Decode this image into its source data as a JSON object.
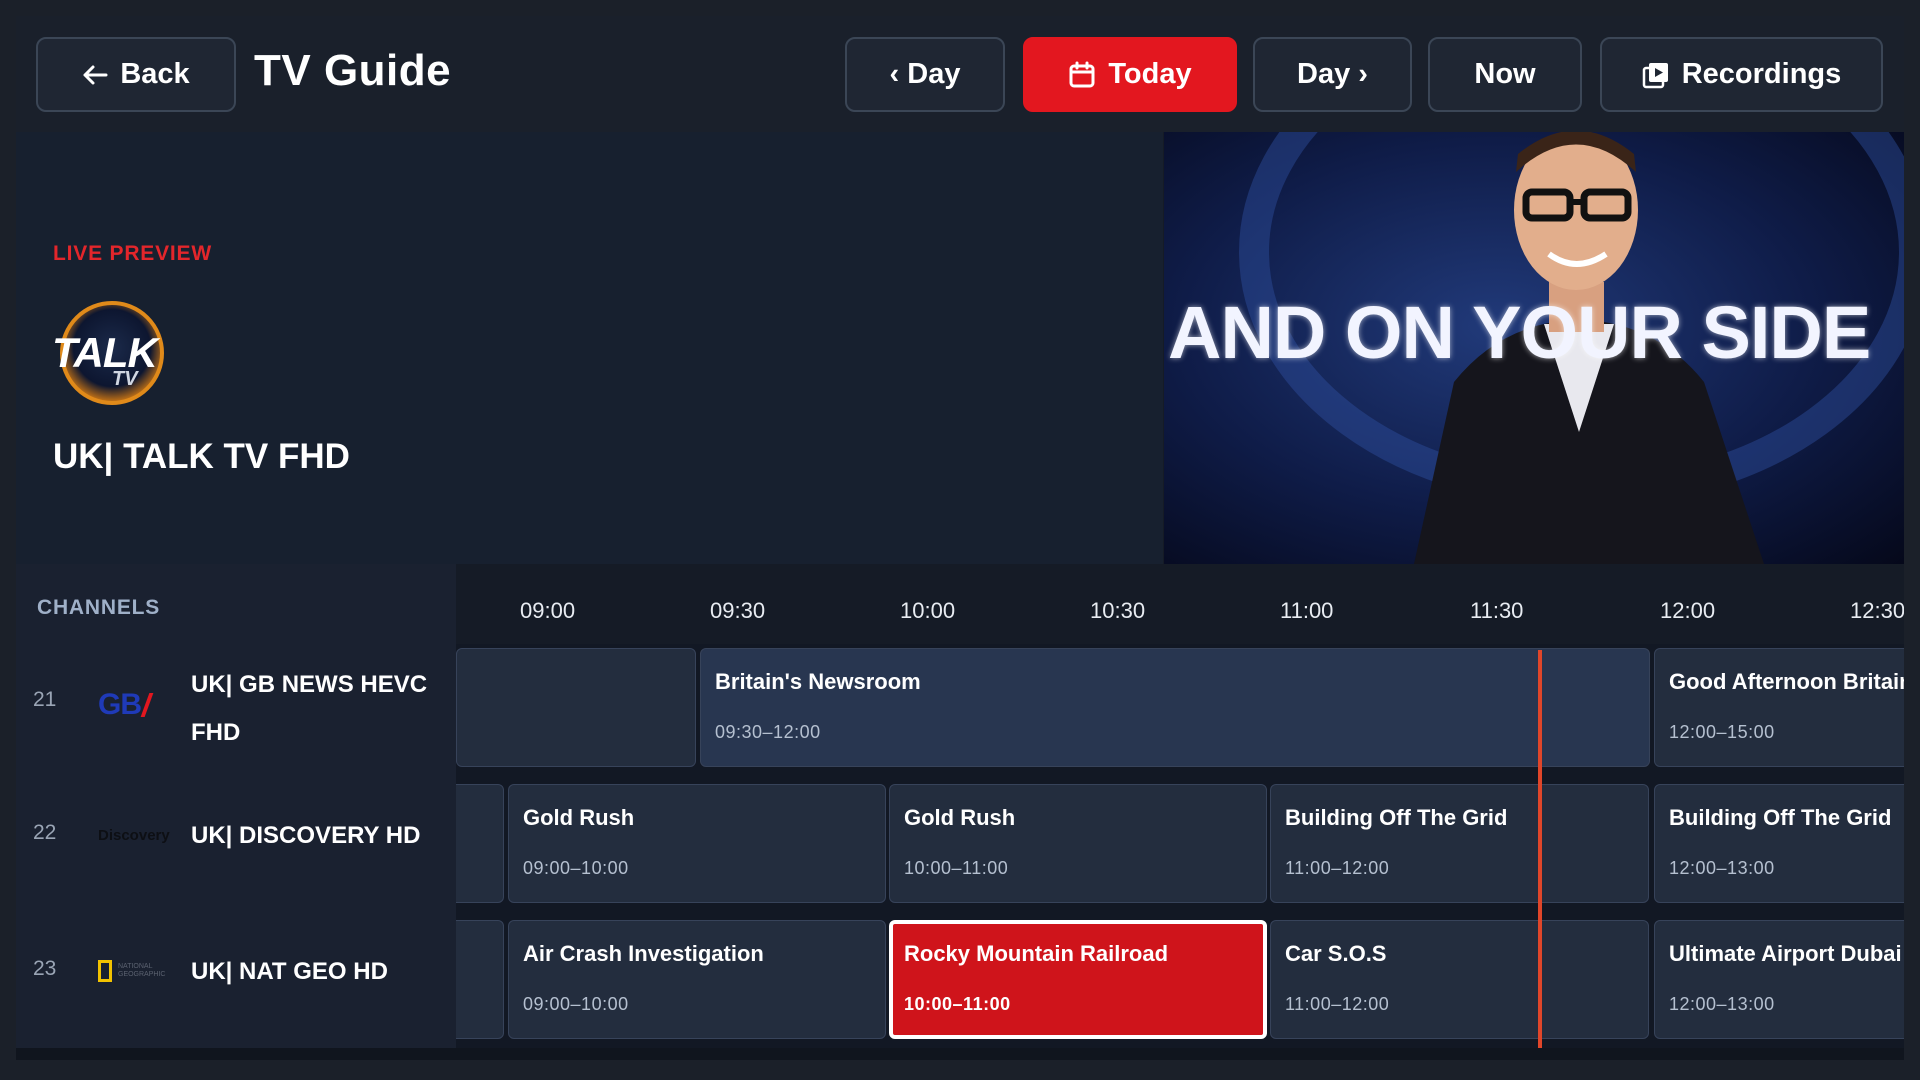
{
  "header": {
    "back_label": "Back",
    "title": "TV Guide",
    "prev_day_label": "‹ Day",
    "today_label": "Today",
    "next_day_label": "Day ›",
    "now_label": "Now",
    "recordings_label": "Recordings"
  },
  "preview": {
    "live_label": "LIVE PREVIEW",
    "channel_logo_text": "TALK",
    "channel_logo_sub": "TV",
    "channel_name": "UK| TALK TV FHD",
    "video_caption": "AND ON YOUR SIDE"
  },
  "channels": {
    "header": "CHANNELS",
    "items": [
      {
        "number": "21",
        "name": "UK| GB NEWS HEVC FHD",
        "logo_text": "GB"
      },
      {
        "number": "22",
        "name": "UK| DISCOVERY HD",
        "logo_text": "Discovery"
      },
      {
        "number": "23",
        "name": "UK| NAT GEO HD",
        "logo_text": "NATIONAL GEOGRAPHIC"
      }
    ]
  },
  "timeline": {
    "labels": [
      "09:00",
      "09:30",
      "10:00",
      "10:30",
      "11:00",
      "11:30",
      "12:00",
      "12:30"
    ]
  },
  "programs": {
    "row1": [
      {
        "title": "",
        "time": ""
      },
      {
        "title": "Britain's Newsroom",
        "time": "09:30–12:00"
      },
      {
        "title": "Good Afternoon Britain",
        "time": "12:00–15:00"
      }
    ],
    "row2": [
      {
        "title": "",
        "time": ""
      },
      {
        "title": "Gold Rush",
        "time": "09:00–10:00"
      },
      {
        "title": "Gold Rush",
        "time": "10:00–11:00"
      },
      {
        "title": "Building Off The Grid",
        "time": "11:00–12:00"
      },
      {
        "title": "Building Off The Grid",
        "time": "12:00–13:00"
      }
    ],
    "row3": [
      {
        "title": "",
        "time": ""
      },
      {
        "title": "Air Crash Investigation",
        "time": "09:00–10:00"
      },
      {
        "title": "Rocky Mountain Railroad",
        "time": "10:00–11:00"
      },
      {
        "title": "Car S.O.S",
        "time": "11:00–12:00"
      },
      {
        "title": "Ultimate Airport Dubai",
        "time": "12:00–13:00"
      }
    ]
  },
  "colors": {
    "accent": "#e3171f",
    "now_line": "#e0462a",
    "background": "#151b26"
  }
}
